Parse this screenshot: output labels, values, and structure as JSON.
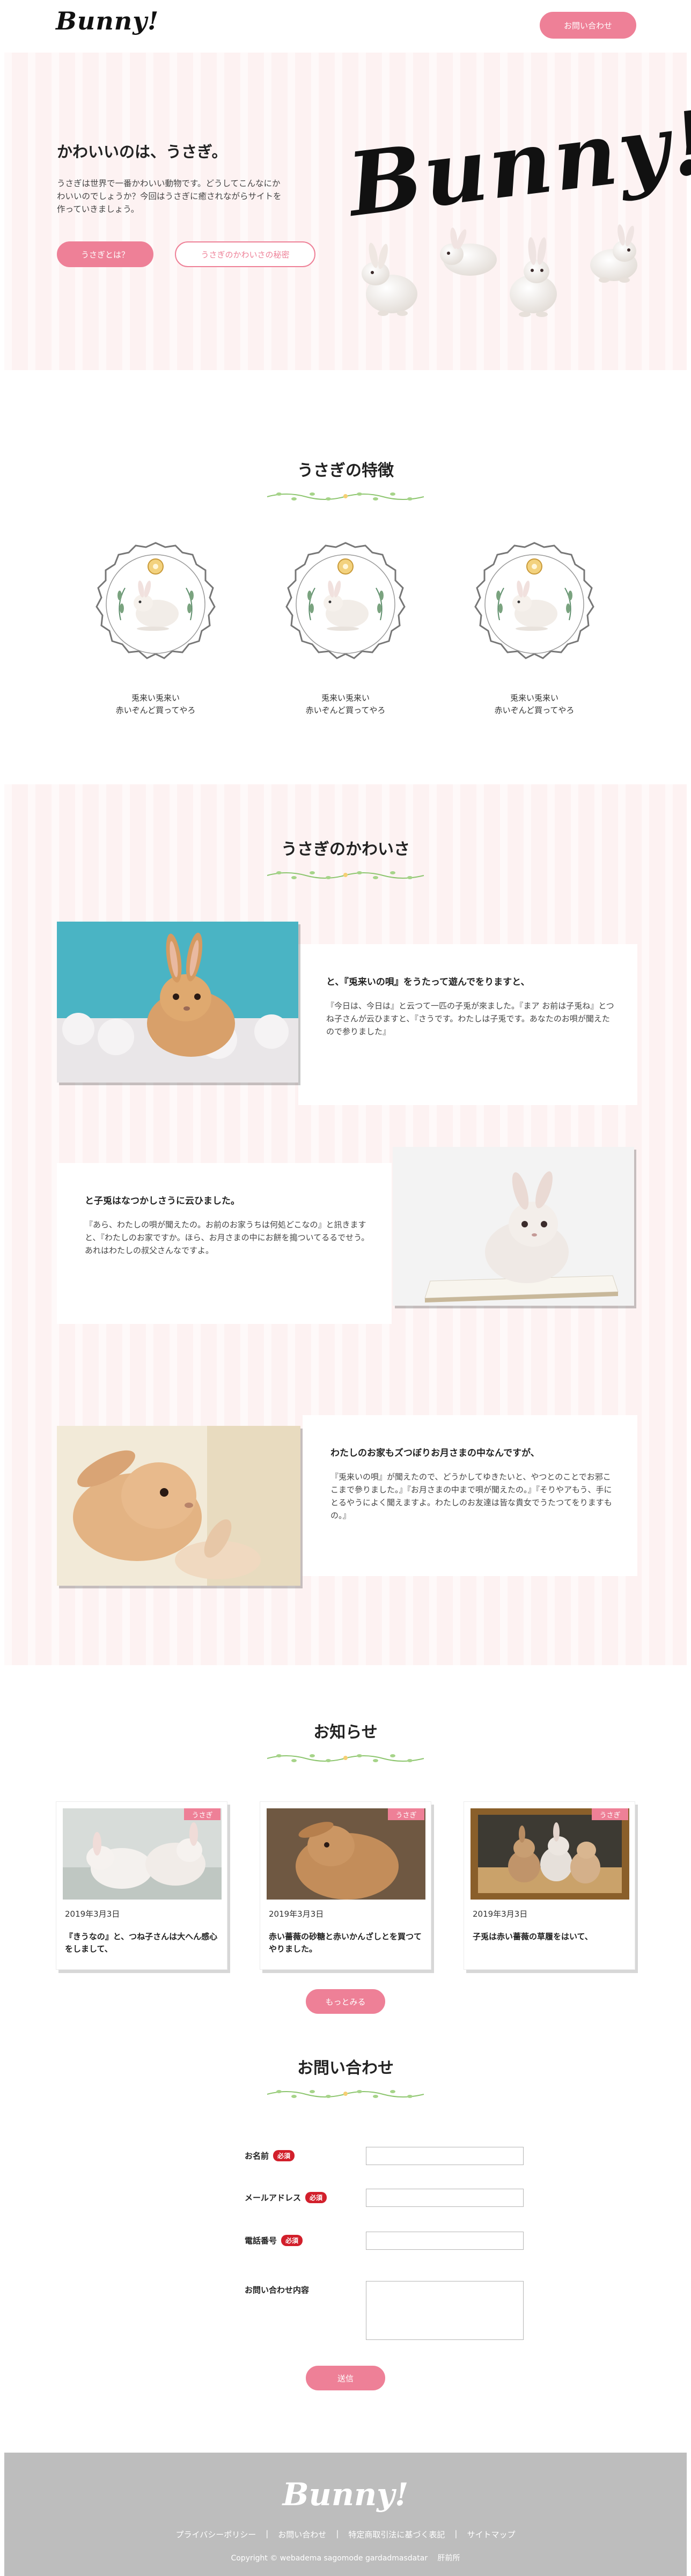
{
  "header": {
    "logo": "Bunny!",
    "contact_button": "お問い合わせ"
  },
  "hero": {
    "title": "かわいいのは、うさぎ。",
    "text": "うさぎは世界で一番かわいい動物です。どうしてこんなにかわいいのでしょうか？今回はうさぎに癒されながらサイトを作っていきましょう。",
    "button_primary": "うさぎとは？",
    "button_secondary": "うさぎのかわいさの秘密",
    "logo_art": "Bunny!"
  },
  "features": {
    "title": "うさぎの特徴",
    "items": [
      {
        "line1": "兎来い兎来い",
        "line2": "赤いぞんど買ってやろ"
      },
      {
        "line1": "兎来い兎来い",
        "line2": "赤いぞんど買ってやろ"
      },
      {
        "line1": "兎来い兎来い",
        "line2": "赤いぞんど買ってやろ"
      }
    ]
  },
  "kawaii": {
    "title": "うさぎのかわいさ",
    "items": [
      {
        "heading": "と、『兎来いの唄』をうたって遊んでをりますと、",
        "text": "『今日は、今日は』と云つて一匹の子兎が來ました。『まア お前は子兎ね』とつね子さんが云ひますと、『さうです。わたしは子兎です。あなたのお唄が聞えたので参りました』"
      },
      {
        "heading": "と子兎はなつかしさうに云ひました。",
        "text": "『あら、わたしの唄が聞えたの。お前のお家うちは何処どこなの』と訊きますと、『わたしのお家ですか。ほら、お月さまの中にお餅を搗ついてるるでせう。あれはわたしの叔父さんなですよ。"
      },
      {
        "heading": "わたしのお家もズつぼりお月さまの中なんですが、",
        "text": "『兎来いの唄』が聞えたので、どうかしてゆきたいと、やつとのことでお邪ここまで參りました。』『お月さまの中まで唄が聞えたの。』『そりやアもう、手にとるやうによく聞えますよ。わたしのお友達は皆な貴女でうたつてをりますもの。』"
      }
    ]
  },
  "news": {
    "title": "お知らせ",
    "items": [
      {
        "tag": "うさぎ",
        "date": "2019年3月3日",
        "title": "『きうなの』と、つね子さんは大へん感心をしまして、"
      },
      {
        "tag": "うさぎ",
        "date": "2019年3月3日",
        "title": "赤い薔薇の砂糖と赤いかんざしとを買つてやりました。"
      },
      {
        "tag": "うさぎ",
        "date": "2019年3月3日",
        "title": "子兎は赤い薔薇の草履をはいて、"
      }
    ],
    "more_button": "もっとみる"
  },
  "contact": {
    "title": "お問い合わせ",
    "fields": [
      {
        "label": "お名前",
        "required": "必須"
      },
      {
        "label": "メールアドレス",
        "required": "必須"
      },
      {
        "label": "電話番号",
        "required": "必須"
      },
      {
        "label": "お問い合わせ内容",
        "required": ""
      }
    ],
    "send_button": "送信"
  },
  "footer": {
    "logo": "Bunny!",
    "links": [
      "プライバシーポリシー",
      "お問い合わせ",
      "特定商取引法に基づく表記",
      "サイトマップ"
    ],
    "separator": "|",
    "copyright": "Copyright © webadema sagomode gardadmasdatar 　肝前所"
  },
  "colors": {
    "accent": "#ee8097",
    "stripe_bg": "#fdf2f2",
    "required": "#d21f2b",
    "footer_bg": "#bdbdbd"
  }
}
